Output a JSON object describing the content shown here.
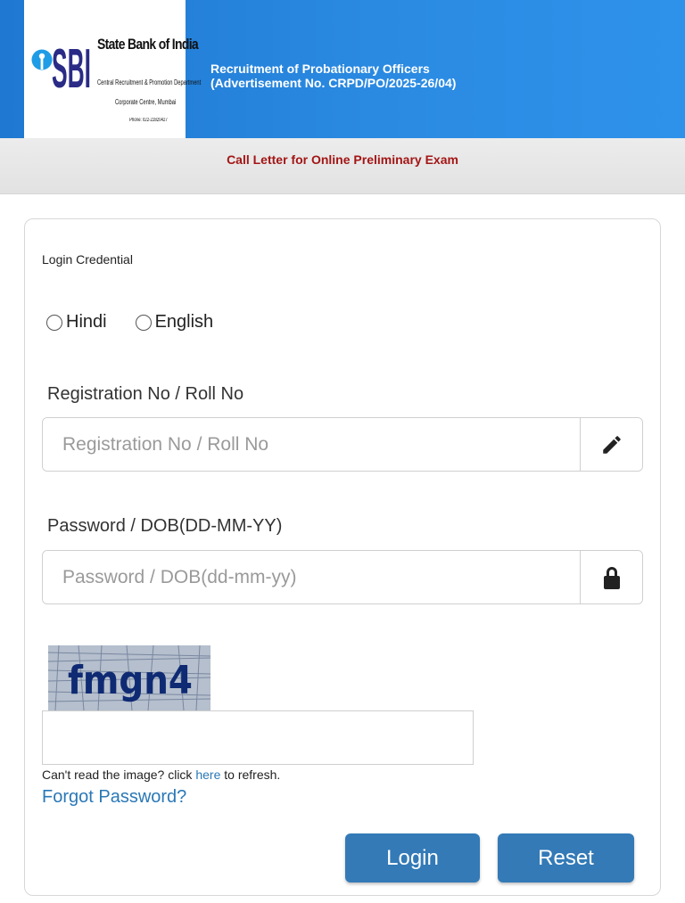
{
  "header": {
    "logo_text": "SBI",
    "bank_name": "State Bank of India",
    "bank_dept": "Central Recruitment & Promotion Department",
    "bank_office": "Corporate Centre, Mumbai",
    "bank_phone": "Phone: 022-22820427",
    "title_line1": "Recruitment of Probationary Officers",
    "title_line2": "(Advertisement No. CRPD/PO/2025-26/04)",
    "brand_color": "#2b8be3"
  },
  "subheader": {
    "title": "Call Letter for Online Preliminary Exam",
    "title_color": "#a31515"
  },
  "form": {
    "section_title": "Login Credential",
    "language_options": [
      "Hindi",
      "English"
    ],
    "registration": {
      "label": "Registration No / Roll No",
      "placeholder": "Registration No / Roll No",
      "icon": "pencil-icon"
    },
    "password": {
      "label": "Password / DOB(DD-MM-YY)",
      "placeholder": "Password / DOB(dd-mm-yy)",
      "icon": "lock-icon"
    },
    "captcha": {
      "image_text": "fmgn4",
      "input_value": "",
      "help_prefix": "Can't read the image? click ",
      "help_link": "here",
      "help_suffix": " to refresh."
    },
    "forgot_password": "Forgot Password?",
    "login_button": "Login",
    "reset_button": "Reset",
    "button_color": "#337ab7"
  }
}
